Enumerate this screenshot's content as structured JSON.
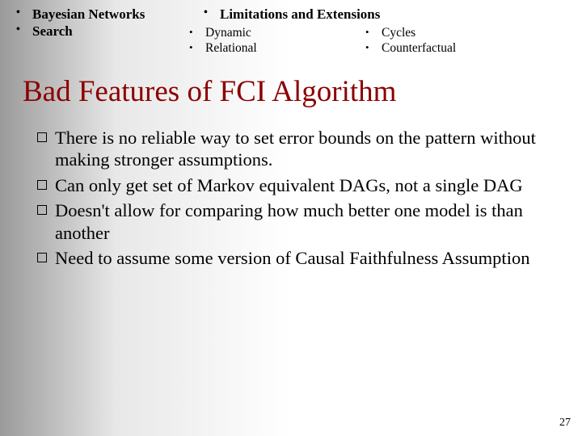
{
  "header": {
    "left": [
      "Bayesian Networks",
      "Search"
    ],
    "right_title": "Limitations and Extensions",
    "right_col1": [
      "Dynamic",
      "Relational"
    ],
    "right_col2": [
      "Cycles",
      "Counterfactual"
    ]
  },
  "title": "Bad Features of FCI Algorithm",
  "points": [
    "There is no reliable way to set error bounds on the pattern without making stronger assumptions.",
    "Can only get set of Markov equivalent DAGs, not a single DAG",
    "Doesn't allow for comparing how much better one model is than another",
    "Need to assume some version of Causal Faithfulness Assumption"
  ],
  "page_number": "27"
}
